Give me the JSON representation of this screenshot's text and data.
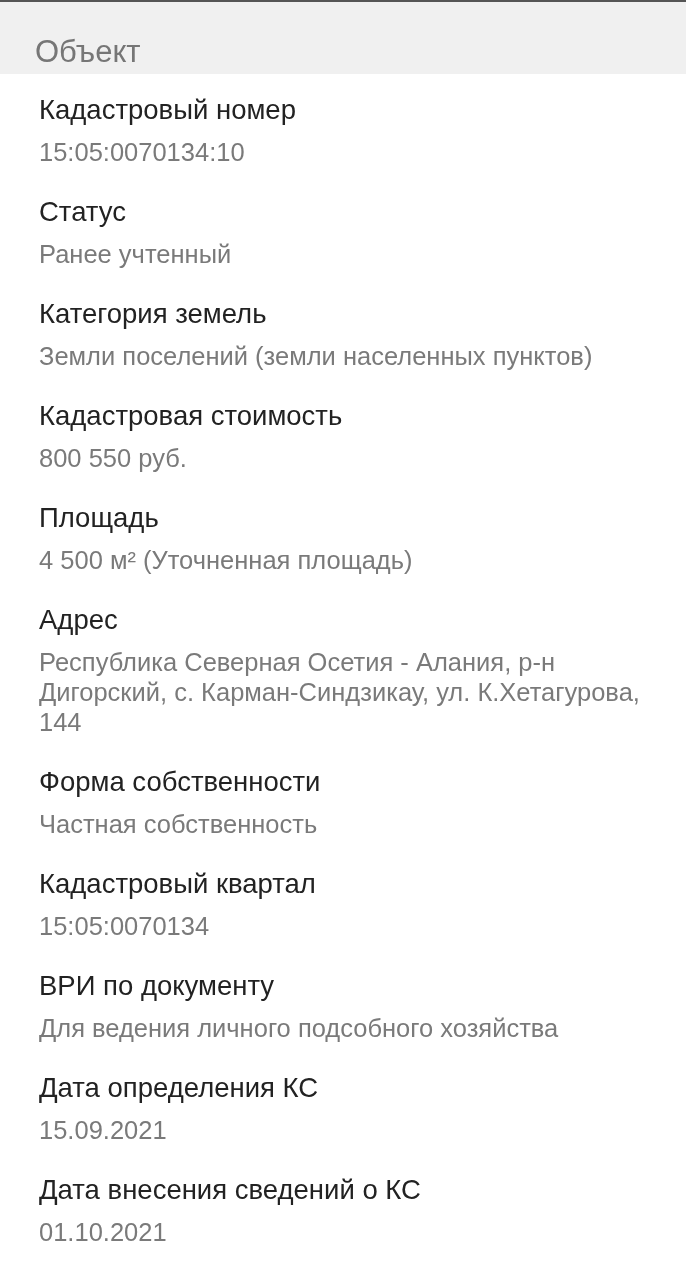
{
  "header": {
    "title": "Объект"
  },
  "fields": [
    {
      "label": "Кадастровый номер",
      "value": "15:05:0070134:10"
    },
    {
      "label": "Статус",
      "value": "Ранее учтенный"
    },
    {
      "label": "Категория земель",
      "value": "Земли поселений (земли населенных пунктов)"
    },
    {
      "label": "Кадастровая стоимость",
      "value": "800 550 руб."
    },
    {
      "label": "Площадь",
      "value": "4 500 м² (Уточненная площадь)"
    },
    {
      "label": "Адрес",
      "value": "Республика Северная Осетия - Алания, р-н Дигорский, с. Карман-Синдзикау, ул. К.Хетагурова, 144"
    },
    {
      "label": "Форма собственности",
      "value": "Частная собственность"
    },
    {
      "label": "Кадастровый квартал",
      "value": "15:05:0070134"
    },
    {
      "label": "ВРИ по документу",
      "value": "Для ведения личного подсобного хозяйства"
    },
    {
      "label": "Дата определения КС",
      "value": "15.09.2021"
    },
    {
      "label": "Дата внесения сведений о КС",
      "value": "01.10.2021"
    }
  ]
}
